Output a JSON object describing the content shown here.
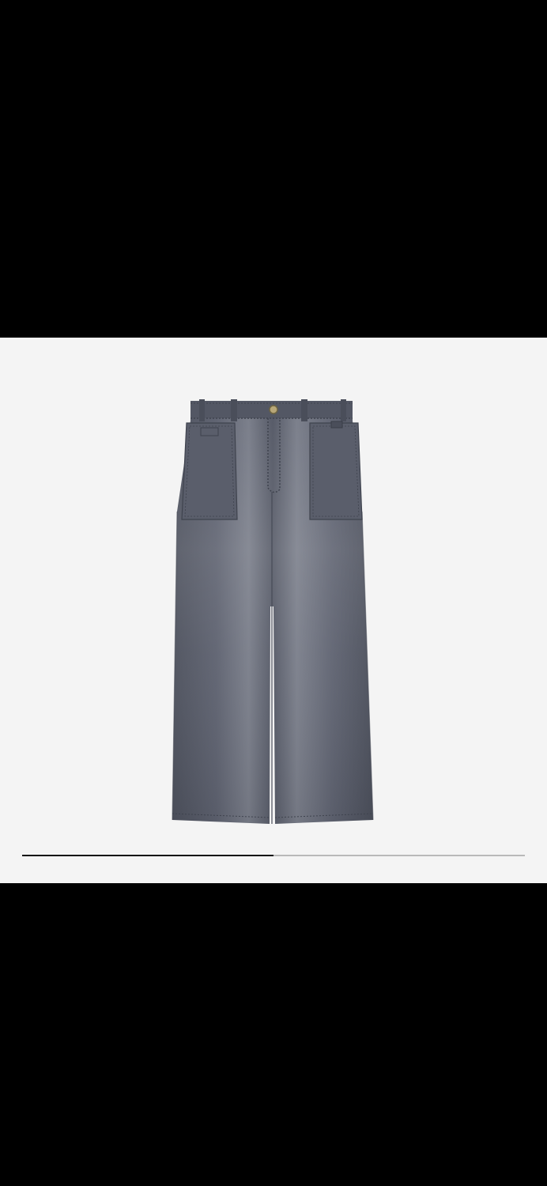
{
  "viewer": {
    "image_alt": "",
    "background_color": "#f4f4f4",
    "denim_color": "#5b5f6a"
  },
  "progress": {
    "fraction": 0.5,
    "track_color": "#b9b9b9",
    "fill_color": "#111111"
  }
}
